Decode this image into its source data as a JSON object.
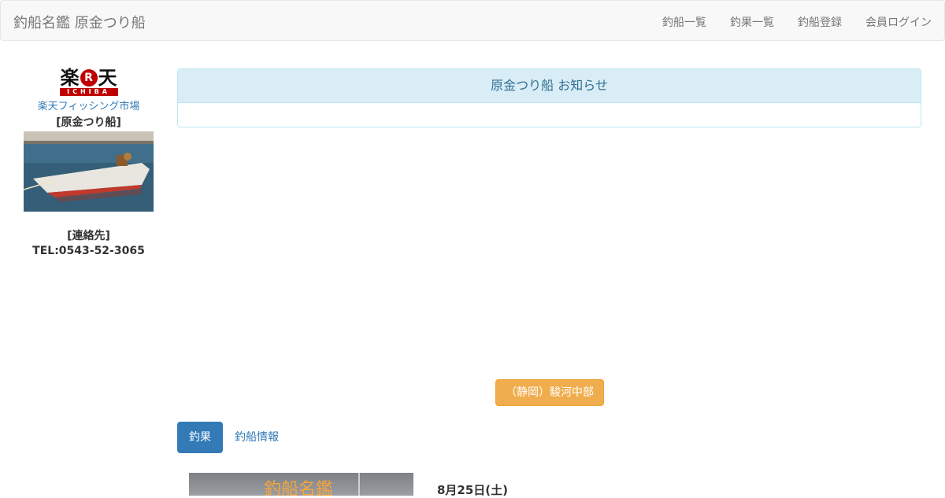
{
  "navbar": {
    "brand": "釣船名鑑 原金つり船",
    "links": [
      "釣船一覧",
      "釣果一覧",
      "釣船登録",
      "会員ログイン"
    ]
  },
  "sidebar": {
    "logo_main": [
      "楽",
      "R",
      "天"
    ],
    "logo_sub": "ICHIBA",
    "shop_link": "楽天フィッシング市場",
    "boat_name": "[原金つり船]",
    "contact_label": "[連絡先]",
    "tel": "TEL:0543-52-3065"
  },
  "notice": {
    "title": "原金つり船 お知らせ",
    "body": ""
  },
  "area_button": "（静岡）駿河中部",
  "tabs": [
    {
      "label": "釣果",
      "active": true
    },
    {
      "label": "釣船情報",
      "active": false
    }
  ],
  "report": {
    "thumb_text": "釣船名鑑",
    "date": "8月25日(土)"
  },
  "colors": {
    "primary": "#337ab7",
    "warning": "#f0ad4e",
    "info_bg": "#d9edf7",
    "rakuten_red": "#bf0000"
  }
}
